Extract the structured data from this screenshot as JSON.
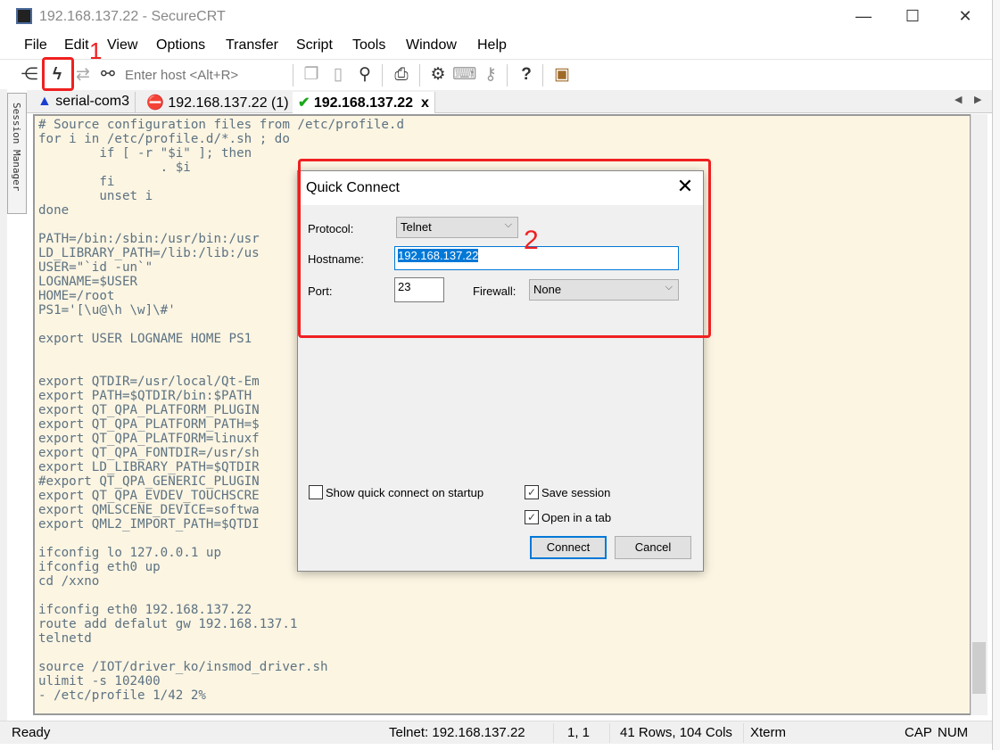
{
  "window": {
    "title": "192.168.137.22 - SecureCRT",
    "minimize": "—",
    "maximize": "☐",
    "close": "✕"
  },
  "menu": [
    "File",
    "Edit",
    "View",
    "Options",
    "Transfer",
    "Script",
    "Tools",
    "Window",
    "Help"
  ],
  "toolbar": {
    "host_placeholder": "Enter host <Alt+R>",
    "icons": [
      "connect-icon",
      "quick-connect-icon",
      "reconnect-icon",
      "disconnect-icon",
      "copy-icon",
      "paste-icon",
      "find-icon",
      "print-icon",
      "settings-icon",
      "keymap-icon",
      "key-icon",
      "help-icon",
      "sftp-icon"
    ]
  },
  "session_manager": {
    "label": "Session Manager"
  },
  "tabs": [
    {
      "label": "serial-com3",
      "status": "warning"
    },
    {
      "label": "192.168.137.22 (1)",
      "status": "error"
    },
    {
      "label": "192.168.137.22",
      "status": "connected",
      "close": "x"
    }
  ],
  "terminal": {
    "lines": [
      "# Source configuration files from /etc/profile.d",
      "for i in /etc/profile.d/*.sh ; do",
      "        if [ -r \"$i\" ]; then",
      "                . $i",
      "        fi",
      "        unset i",
      "done",
      "",
      "PATH=/bin:/sbin:/usr/bin:/usr",
      "LD_LIBRARY_PATH=/lib:/lib:/us",
      "USER=\"`id -un`\"",
      "LOGNAME=$USER",
      "HOME=/root",
      "PS1='[\\u@\\h \\w]\\#'",
      "",
      "export USER LOGNAME HOME PS1",
      "",
      "",
      "export QTDIR=/usr/local/Qt-Em",
      "export PATH=$QTDIR/bin:$PATH",
      "export QT_QPA_PLATFORM_PLUGIN",
      "export QT_QPA_PLATFORM_PATH=$",
      "export QT_QPA_PLATFORM=linuxf",
      "export QT_QPA_FONTDIR=/usr/sh",
      "export LD_LIBRARY_PATH=$QTDIR",
      "#export QT_QPA_GENERIC_PLUGIN",
      "export QT_QPA_EVDEV_TOUCHSCRE",
      "export QMLSCENE_DEVICE=softwa",
      "export QML2_IMPORT_PATH=$QTDI",
      "",
      "ifconfig lo 127.0.0.1 up",
      "ifconfig eth0 up",
      "cd /xxno",
      "",
      "ifconfig eth0 192.168.137.22",
      "route add defalut gw 192.168.137.1",
      "telnetd",
      "",
      "source /IOT/driver_ko/insmod_driver.sh",
      "ulimit -s 102400",
      "- /etc/profile 1/42 2%"
    ]
  },
  "statusbar": {
    "ready": "Ready",
    "connection": "Telnet: 192.168.137.22",
    "cursor": "1,   1",
    "size": "41 Rows, 104 Cols",
    "terminal_type": "Xterm",
    "cap": "CAP",
    "num": "NUM"
  },
  "dialog": {
    "title": "Quick Connect",
    "close": "✕",
    "protocol_label": "Protocol:",
    "protocol_value": "Telnet",
    "hostname_label": "Hostname:",
    "hostname_value": "192.168.137.22",
    "port_label": "Port:",
    "port_value": "23",
    "firewall_label": "Firewall:",
    "firewall_value": "None",
    "show_on_startup_label": "Show quick connect on startup",
    "show_on_startup_checked": false,
    "save_session_label": "Save session",
    "save_session_checked": true,
    "open_in_tab_label": "Open in a tab",
    "open_in_tab_checked": true,
    "connect_label": "Connect",
    "cancel_label": "Cancel"
  },
  "annotations": {
    "step1": "1",
    "step2": "2",
    "color": "#f02020"
  }
}
